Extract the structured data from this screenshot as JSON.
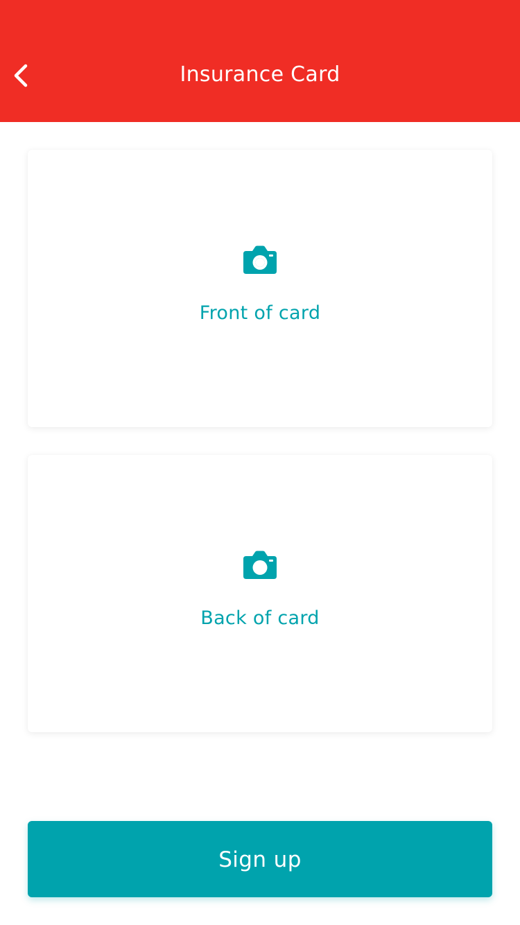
{
  "header": {
    "title": "Insurance Card",
    "background_color": "#f02d25",
    "back_icon": "chevron-left-icon"
  },
  "cards": {
    "front": {
      "label": "Front of card",
      "icon": "camera-icon"
    },
    "back": {
      "label": "Back of card",
      "icon": "camera-icon"
    }
  },
  "accent_color": "#00a3ad",
  "signup_button": {
    "label": "Sign up",
    "color": "#00a3ad"
  }
}
